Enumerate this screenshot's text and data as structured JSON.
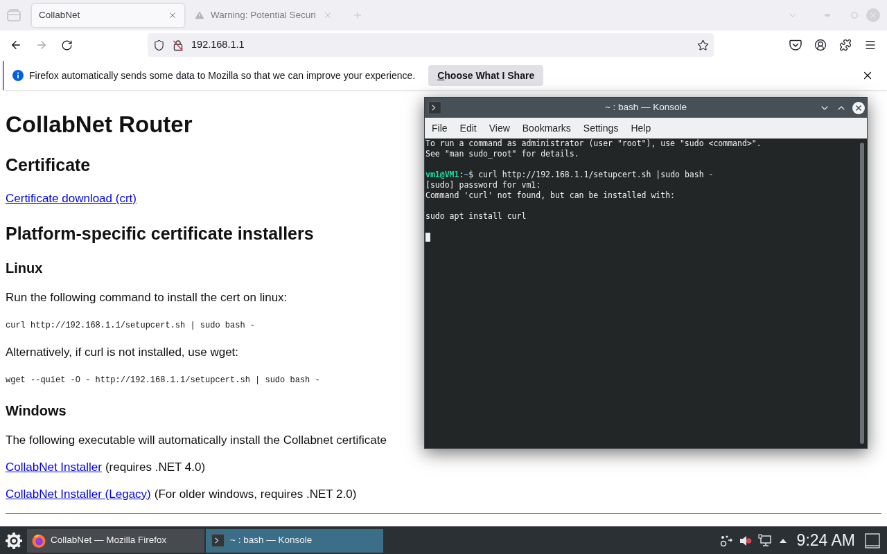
{
  "browser": {
    "tabs": [
      {
        "kind": "page",
        "label": "CollabNet",
        "selected": true
      },
      {
        "kind": "warning",
        "label": "Warning: Potential Securi",
        "selected": false
      }
    ],
    "address_bar": {
      "value": "192.168.1.1"
    },
    "notification": {
      "message": "Firefox automatically sends some data to Mozilla so that we can improve your experience.",
      "button": "Choose What I Share"
    },
    "page": {
      "blocks": [
        {
          "kind": "h1",
          "text": "CollabNet Router"
        },
        {
          "kind": "h2",
          "text": "Certificate"
        },
        {
          "kind": "link",
          "link": "Certificate download (crt)"
        },
        {
          "kind": "h2",
          "text": "Platform-specific certificate installers"
        },
        {
          "kind": "h3",
          "text": "Linux"
        },
        {
          "kind": "p",
          "text": "Run the following command to install the cert on linux:"
        },
        {
          "kind": "code",
          "text": "curl http://192.168.1.1/setupcert.sh | sudo bash -"
        },
        {
          "kind": "p",
          "text": "Alternatively, if curl is not installed, use wget:"
        },
        {
          "kind": "code",
          "text": "wget --quiet -O - http://192.168.1.1/setupcert.sh | sudo bash -"
        },
        {
          "kind": "h3",
          "text": "Windows"
        },
        {
          "kind": "p",
          "text": "The following executable will automatically install the Collabnet certificate"
        },
        {
          "kind": "link",
          "link": "CollabNet Installer",
          "text": "(requires .NET 4.0)"
        },
        {
          "kind": "link",
          "link": "CollabNet Installer (Legacy)",
          "text": "(For older windows, requires .NET 2.0)"
        },
        {
          "kind": "rule"
        }
      ]
    }
  },
  "konsole": {
    "title": "~ : bash — Konsole",
    "menu": [
      "File",
      "Edit",
      "View",
      "Bookmarks",
      "Settings",
      "Help"
    ],
    "paragraphs": [
      {
        "lines": [
          {
            "segments": [
              {
                "kind": "plain",
                "text": "To run a command as administrator (user \"root\"), use \"sudo <command>\"."
              }
            ]
          },
          {
            "segments": [
              {
                "kind": "plain",
                "text": "See \"man sudo_root\" for details."
              }
            ]
          }
        ]
      },
      {
        "lines": [
          {
            "segments": [
              {
                "kind": "user",
                "text": "vm1@VM1"
              },
              {
                "kind": "plain",
                "text": ":"
              },
              {
                "kind": "path",
                "text": "~"
              },
              {
                "kind": "plain",
                "text": "$ curl http://192.168.1.1/setupcert.sh |sudo bash -"
              }
            ]
          },
          {
            "segments": [
              {
                "kind": "plain",
                "text": "[sudo] password for vm1:"
              }
            ]
          },
          {
            "segments": [
              {
                "kind": "plain",
                "text": "Command 'curl' not found, but can be installed with:"
              }
            ]
          }
        ]
      },
      {
        "lines": [
          {
            "segments": [
              {
                "kind": "plain",
                "text": "sudo apt install curl"
              }
            ]
          }
        ]
      }
    ],
    "cursor_visible": true
  },
  "taskbar": {
    "tasks": [
      {
        "kind": "browser",
        "label": "CollabNet — Mozilla Firefox",
        "selected": false
      },
      {
        "kind": "terminal",
        "label": "~ : bash — Konsole",
        "selected": true
      }
    ],
    "clock": "9:24 AM"
  }
}
